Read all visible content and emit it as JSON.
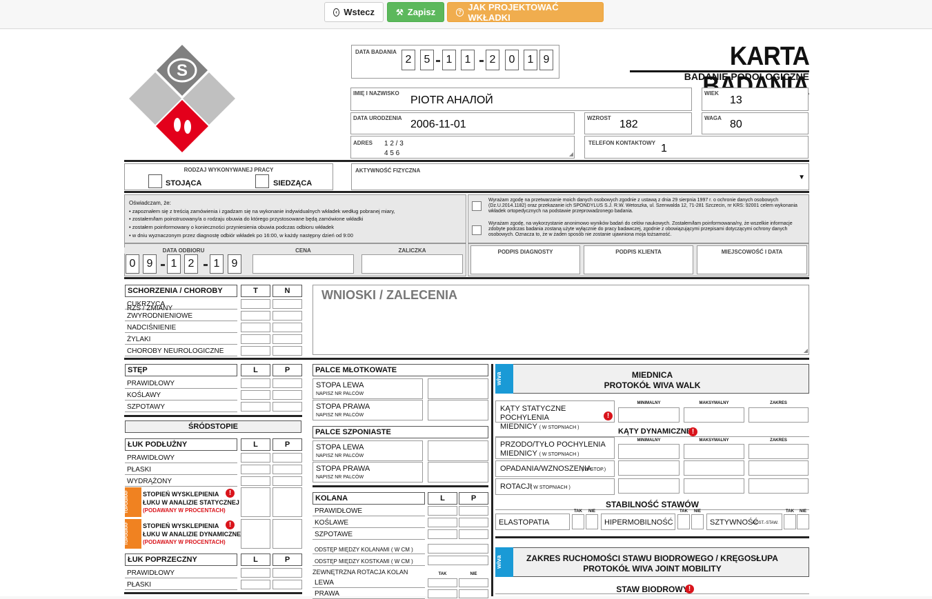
{
  "toolbar": {
    "back": "Wstecz",
    "save": "Zapisz",
    "help": "JAK PROJEKTOWAĆ WKŁADKI"
  },
  "header": {
    "title": "KARTA BADANIA",
    "subtitle": "BADANIE PODOLOGICZNE"
  },
  "exam_date": {
    "label": "DATA BADANIA",
    "digits": [
      "2",
      "5",
      "1",
      "1",
      "2",
      "0",
      "1",
      "9"
    ]
  },
  "patient": {
    "name_label": "IMIĘ I NAZWISKO",
    "name": "PIOTR AHAЛОЙ",
    "age_label": "WIEK",
    "age": "13",
    "dob_label": "DATA URODZENIA",
    "dob": "2006-11-01",
    "height_label": "WZROST",
    "height": "182",
    "weight_label": "WAGA",
    "weight": "80",
    "address_label": "ADRES",
    "address_line1": "1 2 / 3",
    "address_line2": "4 5 6",
    "phone_label": "TELEFON KONTAKTOWY",
    "phone": "1"
  },
  "work": {
    "label": "RODZAJ WYKONYWANEJ PRACY",
    "standing": "STOJĄCA",
    "sitting": "SIEDZĄCA"
  },
  "activity": {
    "label": "AKTYWNOŚĆ FIZYCZNA",
    "value": ""
  },
  "declaration": {
    "intro": "Oświadczam, że:",
    "items": [
      "• zapoznałem się z treścią zamówienia i zgadzam się na wykonanie indywidualnych wkładek według pobranej miary,",
      "• zostałem/łam poinstruowany/a o rodzaju obuwia do którego przystosowane będą zamówione wkładki",
      "• zostałem poinformowany o konieczności przyniesienia obuwia podczas odbioru wkładek",
      "• w dniu wyznaczonym przez diagnostę odbiór wkładek po 16:00, w każdy następny dzień od 9:00"
    ],
    "consent1": "Wyrażam zgodę na przetwarzanie moich danych osobowych zgodnie z ustawą z dnia 29 sierpnia 1997 r. o ochronie danych osobowych (Dz.U.2014.1182) oraz przekazanie ich SPONDYLUS S.J. R.W. Wetoszka, ul. Szenwalda 12, 71-281 Szczecin, nr KRS: 92001 celem wykonania wkładek ortopedycznych na podstawie przeprowadzonego badania.",
    "consent2": "Wyrażam zgodę, na wykorzystanie anonimowo wyników badań do celów naukowych. Zostałem/łam poinformowana/ny, że wszelkie informacje zdobyte podczas badania zostaną użyte wyłącznie do pracy badawczej, zgodnie z obowiązującymi przepisami dotyczącymi ochrony danych osobowych. Oznacza to, że w żaden sposób nie zostanie ujawniona moja tożsamość."
  },
  "pickup": {
    "label": "DATA ODBIORU",
    "digits": [
      "0",
      "9",
      "1",
      "2",
      "1",
      "9"
    ],
    "price_label": "CENA",
    "deposit_label": "ZALICZKA"
  },
  "signatures": {
    "diag": "PODPIS DIAGNOSTY",
    "client": "PODPIS KLIENTA",
    "place": "MIEJSCOWOŚĆ I DATA"
  },
  "diseases": {
    "header": "SCHORZENIA / CHOROBY",
    "t": "T",
    "n": "N",
    "items": [
      "CUKRZYCA",
      "RZS / ZMIANY ZWYRODNIENIOWE",
      "NADCIŚNIENIE",
      "ŻYLAKI",
      "CHOROBY NEUROLOGICZNE"
    ]
  },
  "conclusions": {
    "label": "WNIOSKI / ZALECENIA"
  },
  "foot": {
    "header": "STĘP",
    "l": "L",
    "p": "P",
    "items": [
      "PRAWIDŁOWY",
      "KOŚLAWY",
      "SZPOTAWY"
    ]
  },
  "midfoot": {
    "header": "ŚRÓDSTOPIE"
  },
  "long_arch": {
    "header": "ŁUK PODŁUŻNY",
    "items": [
      "PRAWIDŁOWY",
      "PŁASKI",
      "WYDRĄŻONY"
    ],
    "static_l1": "STOPIEŃ WYSKLEPIENIA",
    "static_l2": "ŁUKU W ANALIZIE STATYCZNEJ",
    "static_l3": "(PODAWANY W PROCENTACH)",
    "dyn_l1": "STOPIEŃ WYSKLEPIENIA",
    "dyn_l2": "ŁUKU W ANALIZIE DYNAMICZNEJ",
    "dyn_l3": "(PODAWANY W PROCENTACH)",
    "ortho_tag": "TOPOGRAF"
  },
  "cross_arch": {
    "header": "ŁUK POPRZECZNY",
    "items": [
      "PRAWIDŁOWY",
      "PŁASKI"
    ]
  },
  "hammer": {
    "header": "PALCE MŁOTKOWATE",
    "left": "STOPA LEWA",
    "right": "STOPA PRAWA",
    "sub": "NAPISZ NR PALCÓW"
  },
  "claw": {
    "header": "PALCE SZPONIASTE",
    "left": "STOPA LEWA",
    "right": "STOPA PRAWA",
    "sub": "NAPISZ NR PALCÓW"
  },
  "knees": {
    "header": "KOLANA",
    "items": [
      "PRAWIDŁOWE",
      "KOŚLAWE",
      "SZPOTAWE"
    ],
    "dist1": "ODSTĘP MIĘDZY KOLANAMI ( W CM )",
    "dist2": "ODSTĘP MIĘDZY KOSTKAMI ( W CM )",
    "rot": "ZEWNĘTRZNA ROTACJA KOLAN",
    "tak": "TAK",
    "nie": "NIE",
    "left": "LEWA",
    "right": "PRAWA"
  },
  "pelvis": {
    "title1": "MIEDNICA",
    "title2": "PROTOKÓŁ WIVA WALK",
    "wiva": "wiva",
    "min": "MINIMALNY",
    "max": "MAKSYMALNY",
    "range": "ZAKRES",
    "static1": "KĄTY STATYCZNE POCHYLENIA",
    "static2": "MIEDNICY",
    "static_unit": "( W STOPNIACH )",
    "dynamic": "KĄTY DYNAMICZNE",
    "fb1": "PRZODO/TYŁO POCHYLENIA",
    "fb2": "MIEDNICY",
    "fb_unit": "( W STOPNIACH )",
    "drop": "OPADANIA/WZNOSZENIA",
    "drop_unit": "( W STOP.)",
    "rot": "ROTACJI",
    "rot_unit": "( W STOPNIACH )",
    "stab": "STABILNOŚĆ STAWÓW",
    "elast": "ELASTOPATIA",
    "hyper": "HIPERMOBILNOŚĆ",
    "stiff": "SZTYWNOŚĆ",
    "stiff_sub": "KOST.-STAW.",
    "tak": "TAK",
    "nie": "NIE"
  },
  "hip": {
    "title1": "ZAKRES RUCHOMOŚCI STAWU BIODROWEGO / KRĘGOSŁUPA",
    "title2": "PROTOKÓŁ WIVA JOINT MOBILITY",
    "hip_joint": "STAW BIODROWY"
  }
}
